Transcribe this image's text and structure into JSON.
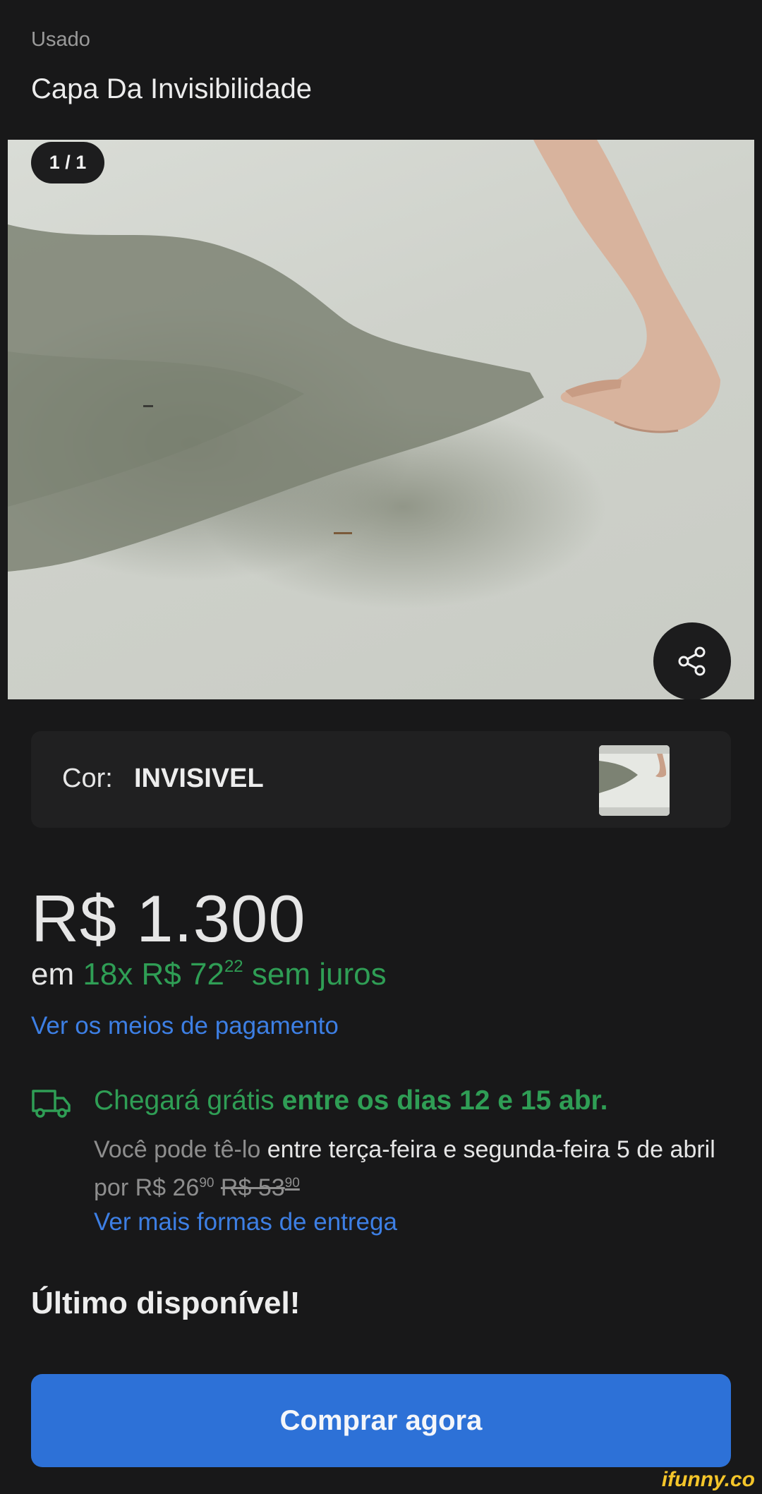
{
  "item": {
    "condition": "Usado",
    "title": "Capa Da Invisibilidade"
  },
  "gallery": {
    "counter": "1 / 1",
    "share_icon": "share-icon"
  },
  "variation": {
    "label": "Cor:",
    "value": "INVISIVEL"
  },
  "price": {
    "amount": "R$ 1.300",
    "installments_prefix": "em",
    "installments_main": "18x R$ 72",
    "installments_cents": "22",
    "installments_suffix": "sem juros",
    "payment_link": "Ver os meios de pagamento"
  },
  "shipping": {
    "icon": "truck-icon",
    "title_regular": "Chegará grátis",
    "title_bold": "entre os dias 12 e 15 abr.",
    "desc_muted_1": "Você pode tê-lo",
    "desc_main": "entre terça-feira e segunda-feira 5 de abril",
    "desc_muted_2": "por R$ 26",
    "price_cents": "90",
    "old_price": "R$ 53",
    "old_price_cents": "90",
    "link": "Ver mais formas de entrega"
  },
  "stock": {
    "label": "Último disponível!"
  },
  "buy_button": {
    "label": "Comprar agora"
  },
  "watermark": {
    "text": "ifunny.co"
  },
  "colors": {
    "background": "#181819",
    "accent_blue": "#2d71d7",
    "link_blue": "#3d7fe4",
    "green": "#2f9e55"
  }
}
